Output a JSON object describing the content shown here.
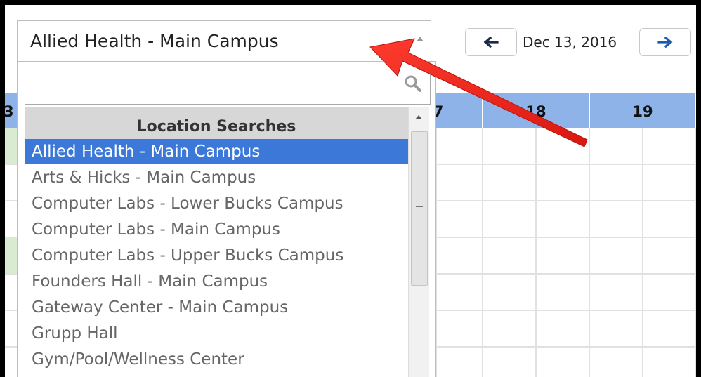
{
  "date_nav": {
    "date": "Dec 13, 2016",
    "prev_icon": "arrow-left-icon",
    "next_icon": "arrow-right-icon"
  },
  "calendar": {
    "day_headers": [
      "7",
      "18",
      "19"
    ]
  },
  "location_select": {
    "selected_value": "Allied Health - Main Campus",
    "search_value": "",
    "group_label": "Location Searches",
    "options": [
      "Allied Health - Main Campus",
      "Arts & Hicks - Main Campus",
      "Computer Labs - Lower Bucks Campus",
      "Computer Labs - Main Campus",
      "Computer Labs - Upper Bucks Campus",
      "Founders Hall - Main Campus",
      "Gateway Center - Main Campus",
      "Grupp Hall",
      "Gym/Pool/Wellness Center"
    ],
    "selected_index": 0
  },
  "colors": {
    "highlight": "#3b78d8",
    "header_blue": "#8db3e8",
    "annotation_arrow": "#e8231e"
  }
}
